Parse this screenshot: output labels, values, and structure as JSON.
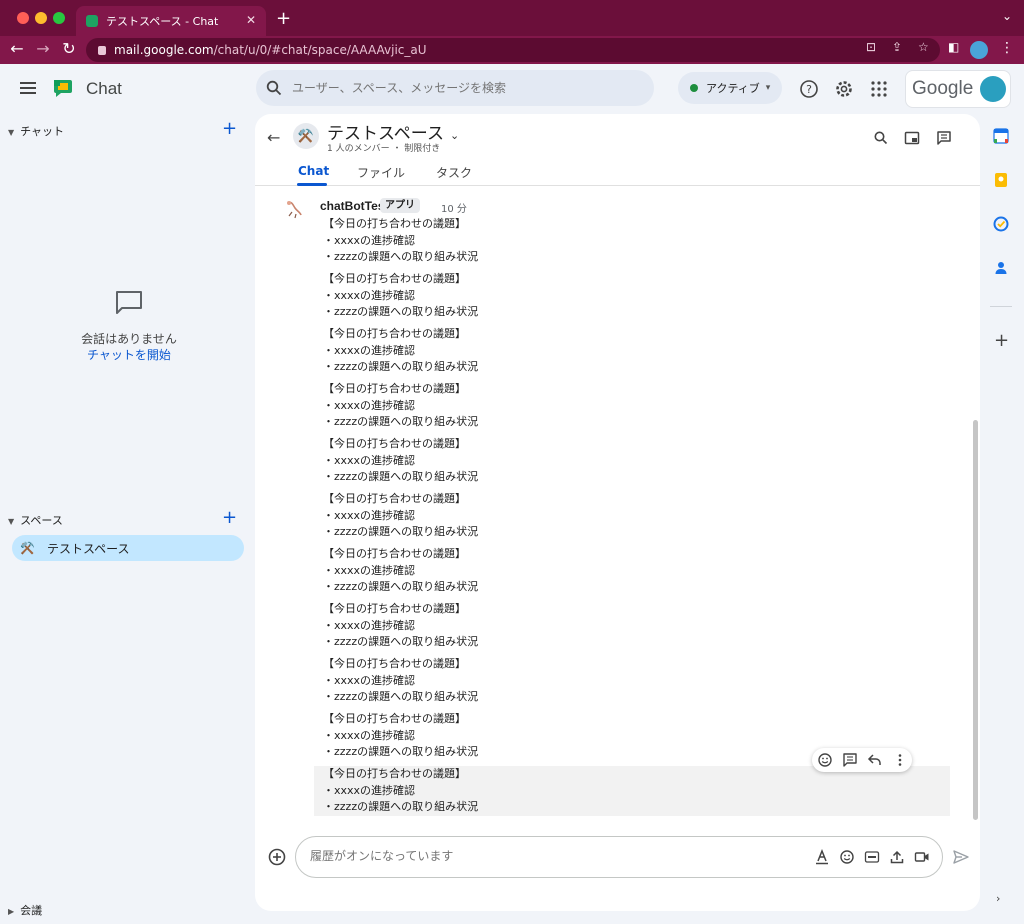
{
  "browser": {
    "tab_title": "テストスペース - Chat",
    "url_host": "mail.google.com",
    "url_path": "/chat/u/0/#chat/space/AAAAvjic_aU"
  },
  "header": {
    "app_title": "Chat",
    "search_placeholder": "ユーザー、スペース、メッセージを検索",
    "status_label": "アクティブ",
    "google_word": "Google"
  },
  "sidebar": {
    "chat_section": "チャット",
    "empty_text": "会話はありません",
    "start_chat_link": "チャットを開始",
    "spaces_section": "スペース",
    "space_item": {
      "emoji": "⚒️",
      "label": "テストスペース"
    },
    "meetings_section": "会議"
  },
  "space": {
    "emoji": "⚒️",
    "title": "テストスペース",
    "subtitle": "1 人のメンバー ・ 制限付き",
    "tabs": [
      "Chat",
      "ファイル",
      "タスク"
    ]
  },
  "message": {
    "sender": "chatBotTest",
    "badge": "アプリ",
    "time": "10 分",
    "line1": "【今日の打ち合わせの議題】",
    "line2": "・xxxxの進捗確認",
    "line3": "・zzzzの課題への取り組み状況",
    "count": 11
  },
  "composer": {
    "placeholder": "履歴がオンになっています"
  },
  "colors": {
    "accent": "#0b57d0",
    "browser_frame": "#6b0f3a",
    "active_space_bg": "#c2e7ff",
    "status_green": "#1e8e3e"
  }
}
